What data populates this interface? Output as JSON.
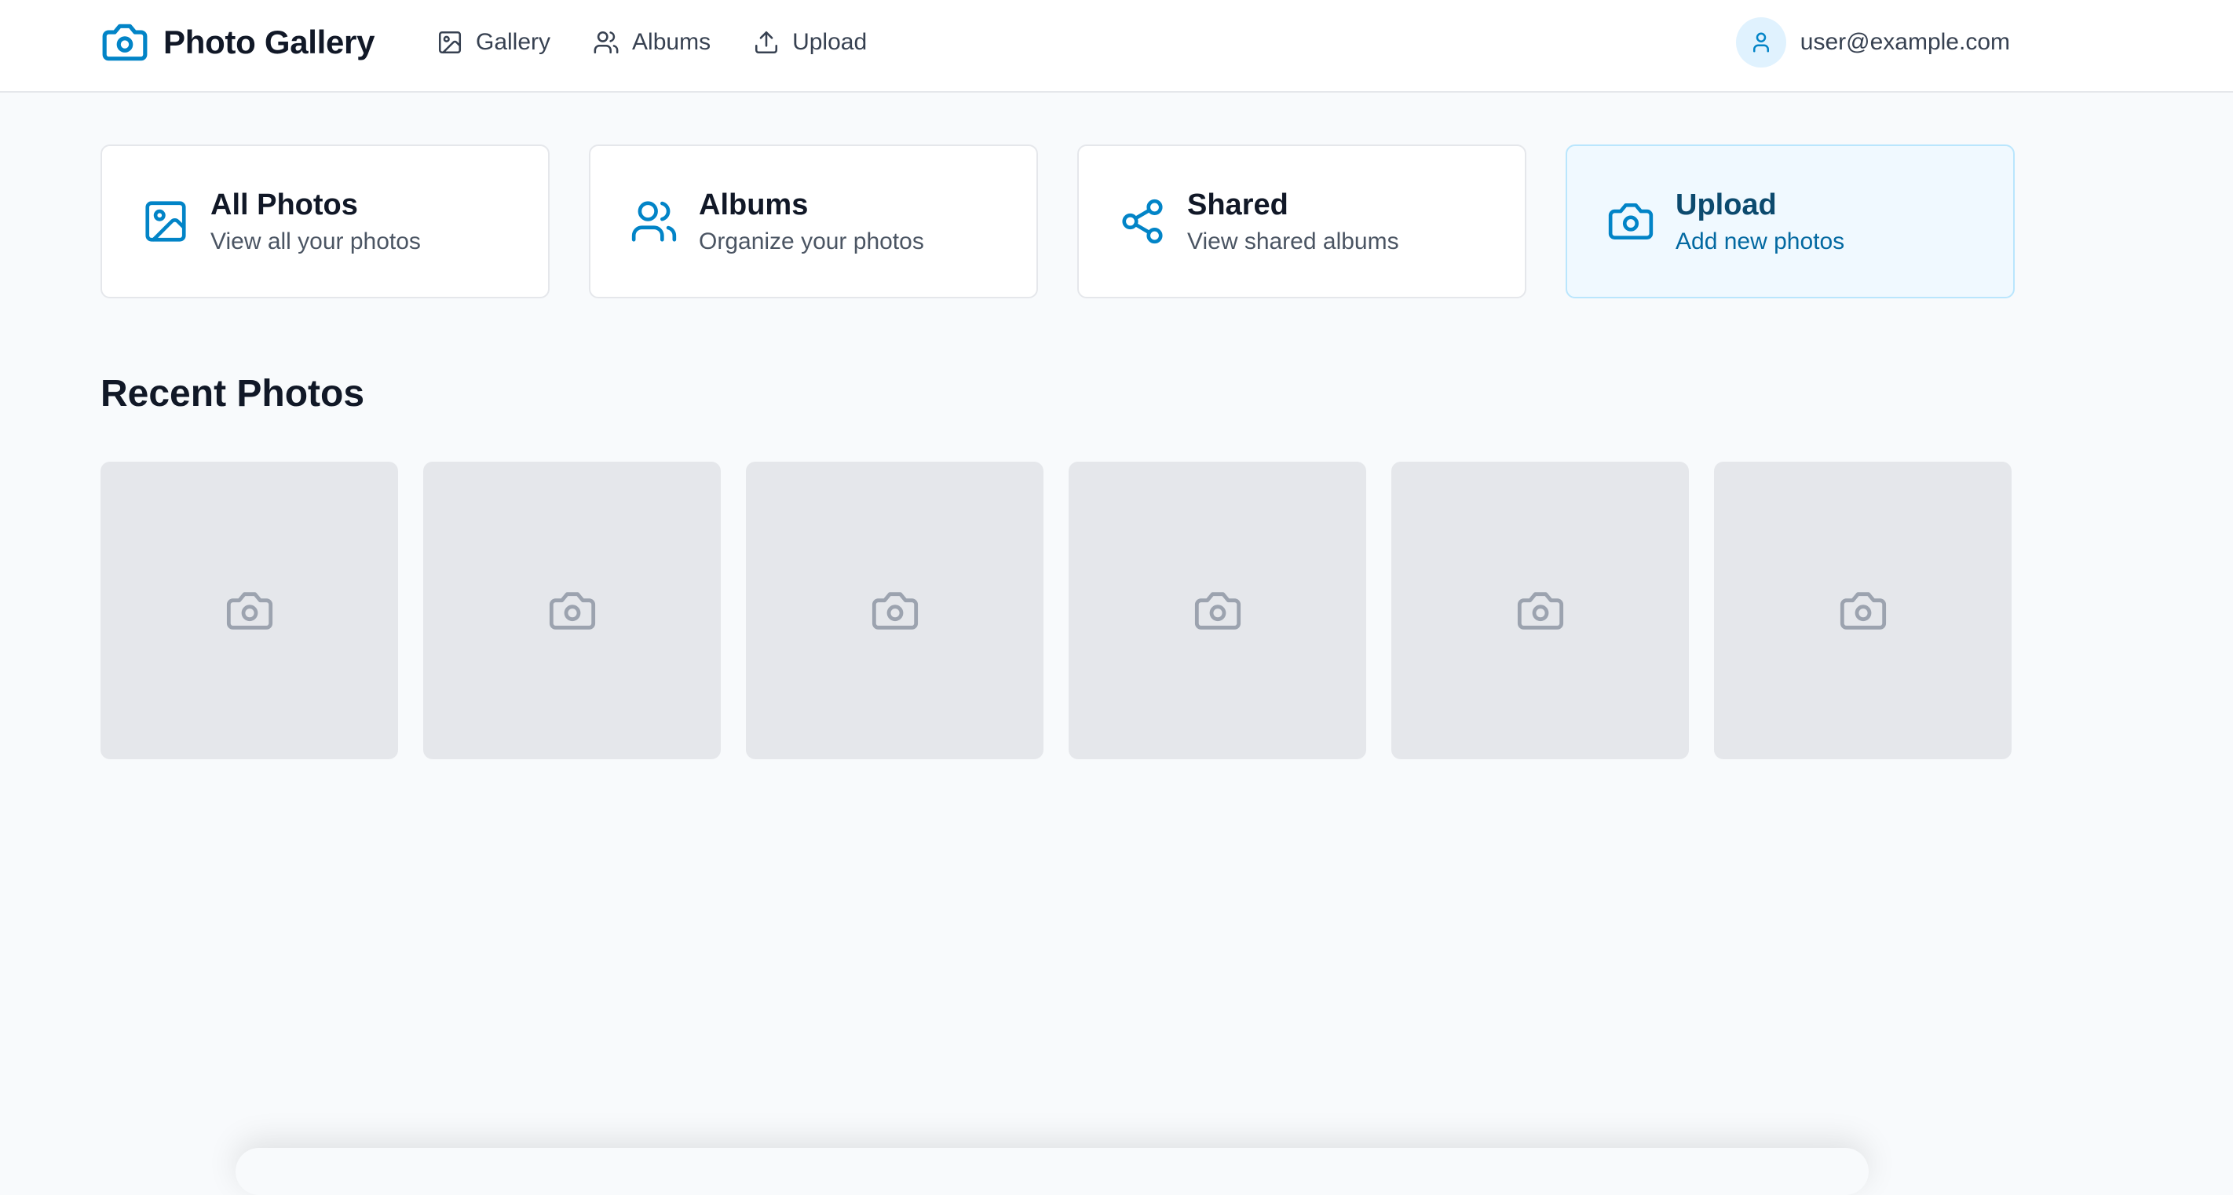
{
  "header": {
    "brand_title": "Photo Gallery",
    "brand_icon": "camera-icon",
    "nav": [
      {
        "label": "Gallery",
        "icon": "image-icon"
      },
      {
        "label": "Albums",
        "icon": "users-icon"
      },
      {
        "label": "Upload",
        "icon": "upload-icon"
      }
    ],
    "user_email": "user@example.com"
  },
  "cards": [
    {
      "title": "All Photos",
      "subtitle": "View all your photos",
      "icon": "image-icon"
    },
    {
      "title": "Albums",
      "subtitle": "Organize your photos",
      "icon": "users-icon"
    },
    {
      "title": "Shared",
      "subtitle": "View shared albums",
      "icon": "share-icon"
    },
    {
      "title": "Upload",
      "subtitle": "Add new photos",
      "icon": "camera-icon"
    }
  ],
  "recent": {
    "title": "Recent Photos",
    "placeholder_count": 6
  },
  "colors": {
    "accent": "#0284c7",
    "placeholder_bg": "#e5e7eb",
    "placeholder_icon": "#9ca3af",
    "highlight_bg": "#f0f9ff"
  }
}
